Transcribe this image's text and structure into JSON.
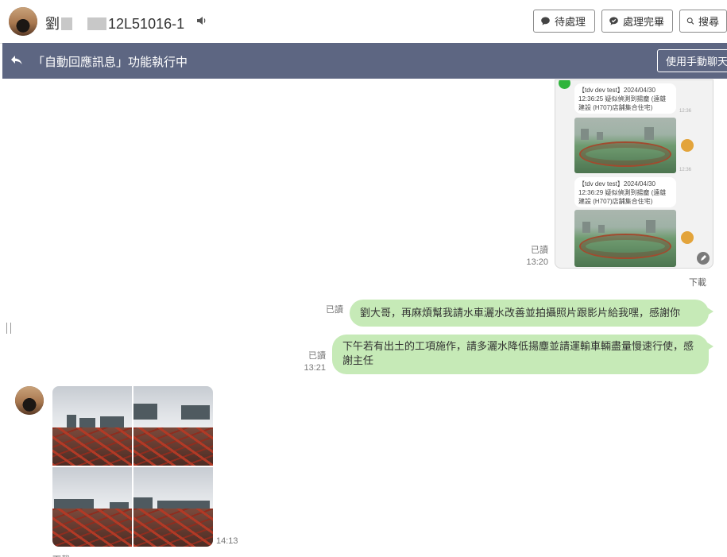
{
  "header": {
    "contact_name_prefix": "劉",
    "contact_name_suffix": "12L51016-1",
    "buttons": {
      "pending": "待處理",
      "done": "處理完畢",
      "search": "搜尋"
    }
  },
  "banner": {
    "text": "「自動回應訊息」功能執行中",
    "manual_button": "使用手動聊天"
  },
  "messages": {
    "screenshot": {
      "read_status": "已讀",
      "time": "13:20",
      "download": "下載",
      "cards": [
        {
          "text": "【tdv dev test】2024/04/30 12:36:25 疑似偵測到揚塵 (遠雄建設 (H707)店舗集合住宅)"
        },
        {
          "text": "【tdv dev test】2024/04/30 12:36:29 疑似偵測到揚塵 (遠雄建設 (H707)店舗集合住宅)"
        }
      ]
    },
    "msg1": {
      "read_status": "已讀",
      "text": "劉大哥，再麻煩幫我請水車灑水改善並拍攝照片跟影片給我嘿，感謝你"
    },
    "msg2": {
      "read_status": "已讀",
      "time": "13:21",
      "text": "下午若有出土的工項施作，請多灑水降低揚塵並請運輸車輛盡量慢速行使，感謝主任"
    },
    "photos": {
      "time": "14:13",
      "download": "下載",
      "count": 4
    }
  },
  "colors": {
    "banner_bg": "#5d6682",
    "bubble_bg": "#c6eab7"
  }
}
